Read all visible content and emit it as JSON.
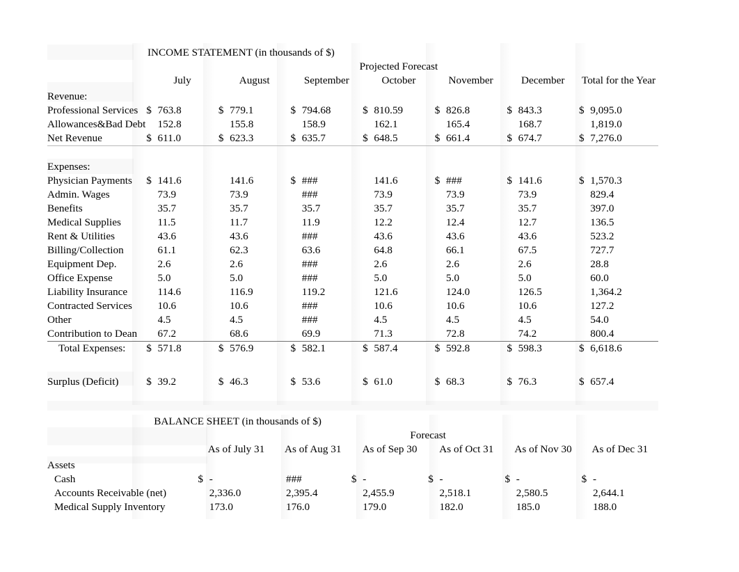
{
  "income_statement": {
    "title": "INCOME STATEMENT (in thousands of $)",
    "subtitle": "Projected Forecast",
    "columns": [
      "July",
      "August",
      "September",
      "October",
      "November",
      "December",
      "Total for the Year"
    ],
    "sections": {
      "revenue_header": "Revenue:",
      "expenses_header": "Expenses:"
    },
    "rows": [
      {
        "label": "Professional Services",
        "sym": "$",
        "values": [
          "763.8",
          "779.1",
          "794.68",
          "810.59",
          "826.8",
          "843.3"
        ],
        "total": "9,095.0",
        "total_sym": "$",
        "val_syms": [
          "$",
          "$",
          "$",
          "$",
          "$",
          "$"
        ]
      },
      {
        "label": "Allowances&Bad Debt",
        "sym": "",
        "values": [
          "152.8",
          "155.8",
          "158.9",
          "162.1",
          "165.4",
          "168.7"
        ],
        "total": "1,819.0",
        "total_sym": "",
        "val_syms": [
          "",
          "",
          "",
          "",
          "",
          ""
        ]
      },
      {
        "label": "Net Revenue",
        "sym": "$",
        "values": [
          "611.0",
          "623.3",
          "635.7",
          "648.5",
          "661.4",
          "674.7"
        ],
        "total": "7,276.0",
        "total_sym": "$",
        "val_syms": [
          "$",
          "$",
          "$",
          "$",
          "$",
          "$"
        ]
      },
      {
        "label": "Physician Payments",
        "sym": "$",
        "values": [
          "141.6",
          "141.6",
          "###",
          "141.6",
          "###",
          "141.6"
        ],
        "total": "1,570.3",
        "total_sym": "$",
        "val_syms": [
          "$",
          "",
          "$",
          "",
          "$",
          "$"
        ]
      },
      {
        "label": "Admin. Wages",
        "sym": "",
        "values": [
          "73.9",
          "73.9",
          "###",
          "73.9",
          "73.9",
          "73.9"
        ],
        "total": "829.4",
        "total_sym": "",
        "val_syms": [
          "",
          "",
          "",
          "",
          "",
          ""
        ]
      },
      {
        "label": "Benefits",
        "sym": "",
        "values": [
          "35.7",
          "35.7",
          "35.7",
          "35.7",
          "35.7",
          "35.7"
        ],
        "total": "397.0",
        "total_sym": "",
        "val_syms": [
          "",
          "",
          "",
          "",
          "",
          ""
        ]
      },
      {
        "label": "Medical Supplies",
        "sym": "",
        "values": [
          "11.5",
          "11.7",
          "11.9",
          "12.2",
          "12.4",
          "12.7"
        ],
        "total": "136.5",
        "total_sym": "",
        "val_syms": [
          "",
          "",
          "",
          "",
          "",
          ""
        ]
      },
      {
        "label": "Rent & Utilities",
        "sym": "",
        "values": [
          "43.6",
          "43.6",
          "###",
          "43.6",
          "43.6",
          "43.6"
        ],
        "total": "523.2",
        "total_sym": "",
        "val_syms": [
          "",
          "",
          "",
          "",
          "",
          ""
        ]
      },
      {
        "label": "Billing/Collection",
        "sym": "",
        "values": [
          "61.1",
          "62.3",
          "63.6",
          "64.8",
          "66.1",
          "67.5"
        ],
        "total": "727.7",
        "total_sym": "",
        "val_syms": [
          "",
          "",
          "",
          "",
          "",
          ""
        ]
      },
      {
        "label": "Equipment Dep.",
        "sym": "",
        "values": [
          "2.6",
          "2.6",
          "###",
          "2.6",
          "2.6",
          "2.6"
        ],
        "total": "28.8",
        "total_sym": "",
        "val_syms": [
          "",
          "",
          "",
          "",
          "",
          ""
        ]
      },
      {
        "label": "Office Expense",
        "sym": "",
        "values": [
          "5.0",
          "5.0",
          "###",
          "5.0",
          "5.0",
          "5.0"
        ],
        "total": "60.0",
        "total_sym": "",
        "val_syms": [
          "",
          "",
          "",
          "",
          "",
          ""
        ]
      },
      {
        "label": "Liability Insurance",
        "sym": "",
        "values": [
          "114.6",
          "116.9",
          "119.2",
          "121.6",
          "124.0",
          "126.5"
        ],
        "total": "1,364.2",
        "total_sym": "",
        "val_syms": [
          "",
          "",
          "",
          "",
          "",
          ""
        ]
      },
      {
        "label": "Contracted Services",
        "sym": "",
        "values": [
          "10.6",
          "10.6",
          "###",
          "10.6",
          "10.6",
          "10.6"
        ],
        "total": "127.2",
        "total_sym": "",
        "val_syms": [
          "",
          "",
          "",
          "",
          "",
          ""
        ]
      },
      {
        "label": "Other",
        "sym": "",
        "values": [
          "4.5",
          "4.5",
          "###",
          "4.5",
          "4.5",
          "4.5"
        ],
        "total": "54.0",
        "total_sym": "",
        "val_syms": [
          "",
          "",
          "",
          "",
          "",
          ""
        ]
      },
      {
        "label": "Contribution to Dean",
        "sym": "",
        "values": [
          "67.2",
          "68.6",
          "69.9",
          "71.3",
          "72.8",
          "74.2"
        ],
        "total": "800.4",
        "total_sym": "",
        "val_syms": [
          "",
          "",
          "",
          "",
          "",
          ""
        ]
      },
      {
        "label": "Total Expenses:",
        "sym": "$",
        "values": [
          "571.8",
          "576.9",
          "582.1",
          "587.4",
          "592.8",
          "598.3"
        ],
        "total": "6,618.6",
        "total_sym": "$",
        "val_syms": [
          "$",
          "$",
          "$",
          "$",
          "$",
          "$"
        ]
      },
      {
        "label": "Surplus (Deficit)",
        "sym": "$",
        "values": [
          "39.2",
          "46.3",
          "53.6",
          "61.0",
          "68.3",
          "76.3"
        ],
        "total": "657.4",
        "total_sym": "$",
        "val_syms": [
          "$",
          "$",
          "$",
          "$",
          "$",
          "$"
        ]
      }
    ]
  },
  "balance_sheet": {
    "title": "BALANCE SHEET (in thousands of $)",
    "subtitle": "Forecast",
    "columns": [
      "As of July 31",
      "As of Aug 31",
      "As of Sep 30",
      "As of Oct 31",
      "As of Nov 30",
      "As of Dec 31"
    ],
    "assets_header": "Assets",
    "rows": [
      {
        "label": "Cash",
        "sym": "$",
        "values": [
          "-",
          "###",
          "-",
          "-",
          "-"
        ],
        "last": "-",
        "val_syms": [
          "",
          "$",
          "$",
          "$",
          "$"
        ]
      },
      {
        "label": "Accounts Receivable (net)",
        "sym": "",
        "values": [
          "2,336.0",
          "2,395.4",
          "2,455.9",
          "2,518.1",
          "2,580.5"
        ],
        "last": "2,644.1",
        "val_syms": [
          "",
          "",
          "",
          "",
          ""
        ]
      },
      {
        "label": "Medical Supply Inventory",
        "sym": "",
        "values": [
          "173.0",
          "176.0",
          "179.0",
          "182.0",
          "185.0"
        ],
        "last": "188.0",
        "val_syms": [
          "",
          "",
          "",
          "",
          ""
        ]
      }
    ]
  }
}
